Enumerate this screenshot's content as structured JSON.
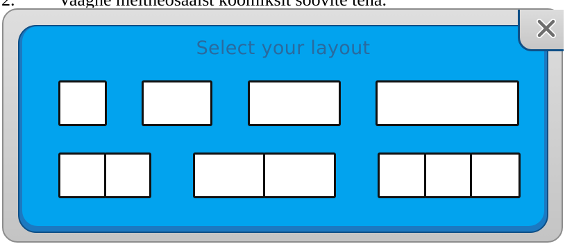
{
  "document": {
    "number": "2.",
    "text": "Vaagne meitneosaalst koomiksit soovite teha."
  },
  "dialog": {
    "title": "Select your layout",
    "close_icon": "close-x-icon",
    "colors": {
      "panel": "#02a3ee",
      "panel_border": "#1c79c1",
      "frame": "#d0d0d0",
      "title": "#2a6a9e"
    }
  },
  "layouts": [
    {
      "label": "1 small panel",
      "panels": 1
    },
    {
      "label": "1 medium panel",
      "panels": 1
    },
    {
      "label": "1 large panel",
      "panels": 1
    },
    {
      "label": "1 wide panel",
      "panels": 1
    },
    {
      "label": "2 panels",
      "panels": 2
    },
    {
      "label": "2 wide panels",
      "panels": 2
    },
    {
      "label": "3 panels",
      "panels": 3
    }
  ]
}
